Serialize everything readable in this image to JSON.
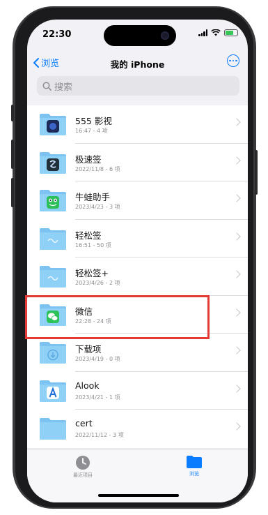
{
  "status": {
    "time": "22:30"
  },
  "nav": {
    "back_label": "浏览",
    "title": "我的 iPhone"
  },
  "search": {
    "placeholder": "搜索"
  },
  "folders": [
    {
      "name": "555 影视",
      "meta": "16:47 - 4 项",
      "badge": "dark-blue"
    },
    {
      "name": "极速签",
      "meta": "2022/11/8 - 6 项",
      "badge": "dark-s"
    },
    {
      "name": "牛蛙助手",
      "meta": "2023/4/23 - 3 项",
      "badge": "green-frog"
    },
    {
      "name": "轻松签",
      "meta": "16:51 - 50 项",
      "badge": "light-sign"
    },
    {
      "name": "轻松签+",
      "meta": "2023/4/26 - 2 项",
      "badge": "light-sign"
    },
    {
      "name": "微信",
      "meta": "22:28 - 24 项",
      "badge": "wechat"
    },
    {
      "name": "下载项",
      "meta": "2023/4/19 - 0 项",
      "badge": "download"
    },
    {
      "name": "Alook",
      "meta": "2023/4/21 - 1 项",
      "badge": "alook"
    },
    {
      "name": "cert",
      "meta": "2022/11/12 - 3 项",
      "badge": "none"
    }
  ],
  "tabs": {
    "recents_label": "最近项目",
    "browse_label": "浏览"
  },
  "colors": {
    "accent": "#0a7cff",
    "highlight": "#e53935",
    "folder": "#7cc3f2"
  }
}
